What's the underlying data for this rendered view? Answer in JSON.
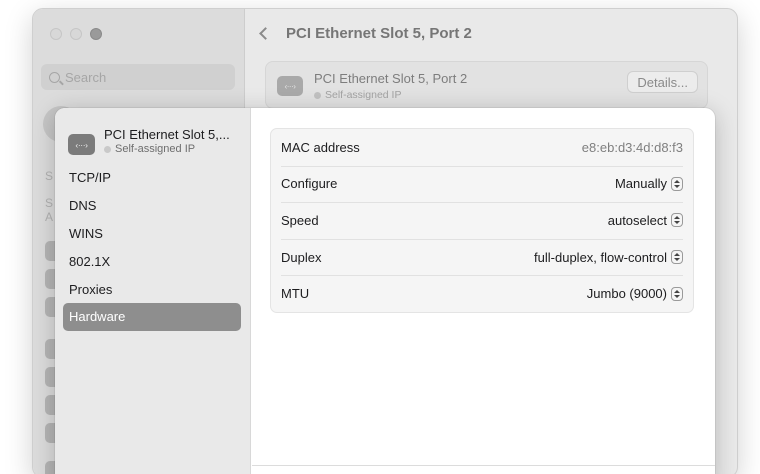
{
  "background": {
    "search_placeholder": "Search",
    "header_title": "PCI Ethernet Slot 5, Port 2",
    "card": {
      "icon_text": "‹···›",
      "name": "PCI Ethernet Slot 5, Port 2",
      "status": "Self-assigned IP",
      "details_label": "Details..."
    },
    "fragments": [
      "S",
      "S",
      "A"
    ]
  },
  "sheet": {
    "header": {
      "icon_text": "‹···›",
      "name": "PCI Ethernet Slot 5,...",
      "status": "Self-assigned IP"
    },
    "nav": [
      {
        "label": "TCP/IP"
      },
      {
        "label": "DNS"
      },
      {
        "label": "WINS"
      },
      {
        "label": "802.1X"
      },
      {
        "label": "Proxies"
      },
      {
        "label": "Hardware"
      }
    ],
    "selected_nav": "Hardware",
    "rows": [
      {
        "label": "MAC address",
        "value": "e8:eb:d3:4d:d8:f3"
      },
      {
        "label": "Configure",
        "value": "Manually"
      },
      {
        "label": "Speed",
        "value": "autoselect"
      },
      {
        "label": "Duplex",
        "value": "full-duplex, flow-control"
      },
      {
        "label": "MTU",
        "value": "Jumbo (9000)"
      }
    ]
  },
  "colors": {
    "selected_nav": "#8e8e8e",
    "status_dot": "#c9c9c9"
  }
}
